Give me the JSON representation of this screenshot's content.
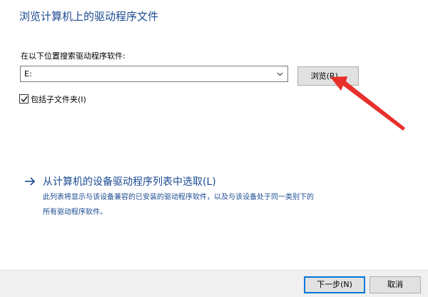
{
  "dialog": {
    "title": "浏览计算机上的驱动程序文件"
  },
  "search": {
    "label": "在以下位置搜索驱动程序软件:",
    "location_value": "E:",
    "browse_label": "浏览(R)...",
    "include_subfolders_label": "包括子文件夹(I)",
    "include_subfolders_checked": true
  },
  "pick_from_list": {
    "link_text": "从计算机的设备驱动程序列表中选取(L)",
    "description_line1": "此列表将显示与该设备兼容的已安装的驱动程序软件，以及与该设备处于同一类别下的",
    "description_line2": "所有驱动程序软件。"
  },
  "footer": {
    "next_label": "下一步(N)",
    "cancel_label": "取消"
  },
  "colors": {
    "heading_blue": "#1a4a91",
    "annotation_red": "#e8302b",
    "focus_border": "#0078d7"
  },
  "icons": {
    "dropdown": "chevron-down-icon",
    "link": "arrow-right-icon",
    "checkbox": "checkmark-icon",
    "annotation": "red-pointer-arrow"
  }
}
